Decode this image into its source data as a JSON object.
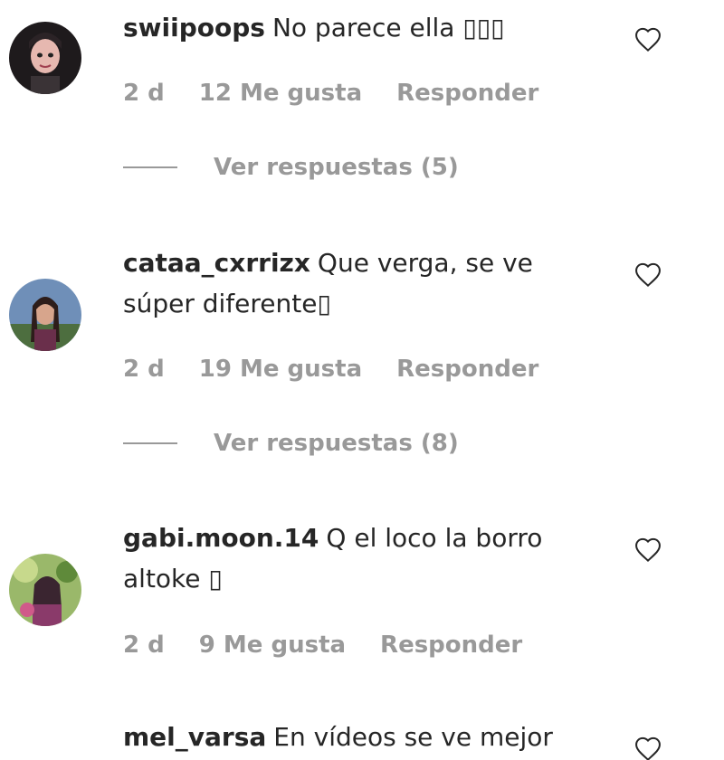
{
  "comments": [
    {
      "username": "swiipoops",
      "text": "No parece ella ▯▯▯",
      "time": "2 d",
      "likes": "12 Me gusta",
      "reply_label": "Responder",
      "view_replies": "Ver respuestas (5)"
    },
    {
      "username": "cataa_cxrrizx",
      "text": "Que verga, se ve súper diferente▯",
      "time": "2 d",
      "likes": "19 Me gusta",
      "reply_label": "Responder",
      "view_replies": "Ver respuestas (8)"
    },
    {
      "username": "gabi.moon.14",
      "text": "Q el loco la borro altoke ▯",
      "time": "2 d",
      "likes": "9 Me gusta",
      "reply_label": "Responder"
    },
    {
      "username": "mel_varsa",
      "text": "En vídeos se ve mejor"
    }
  ],
  "colors": {
    "text": "#262626",
    "secondary": "#999999",
    "icon": "#262626"
  }
}
